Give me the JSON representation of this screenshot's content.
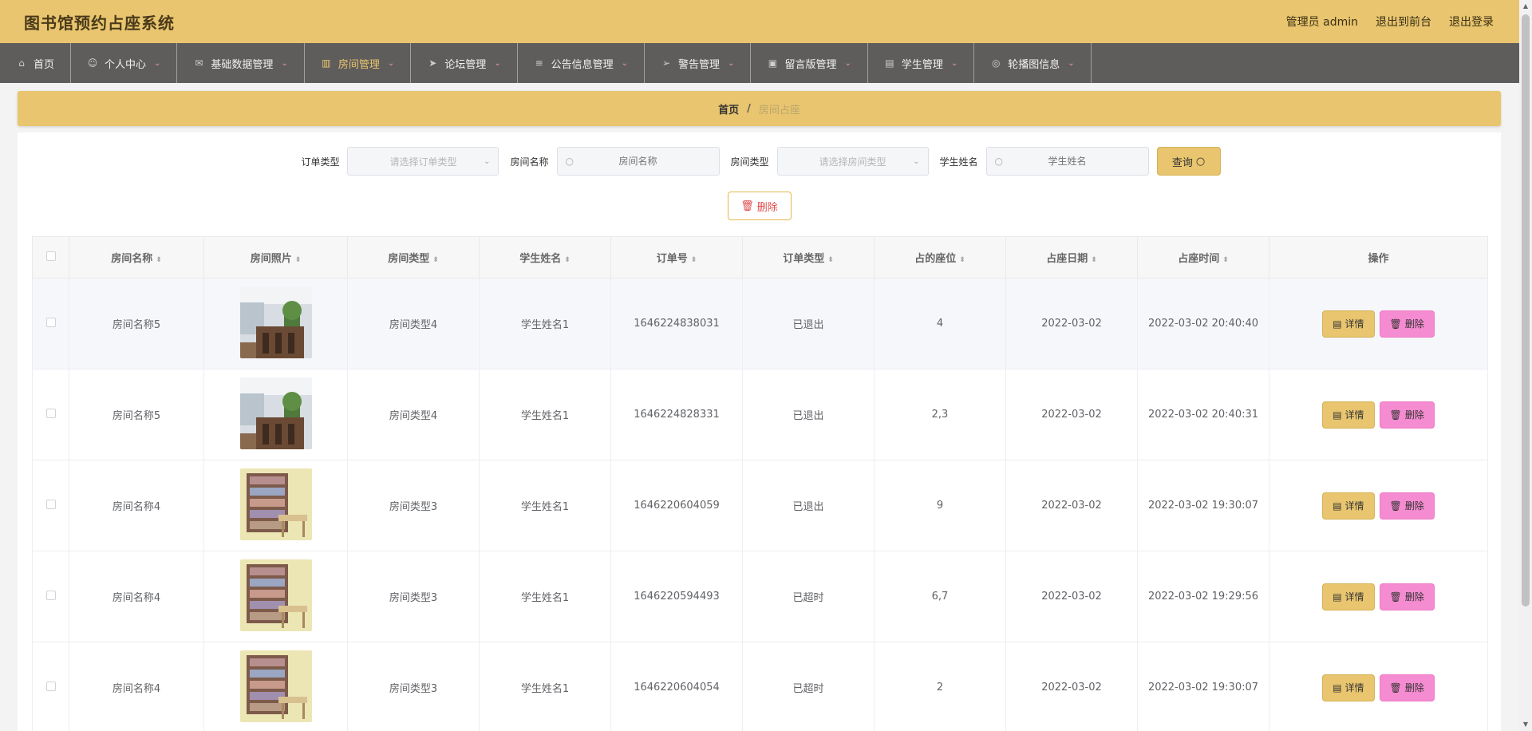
{
  "header": {
    "title": "图书馆预约占座系统",
    "admin_label": "管理员 admin",
    "to_front": "退出到前台",
    "logout": "退出登录"
  },
  "nav": [
    {
      "label": "首页",
      "icon": "home-icon",
      "glyph": "⌂",
      "has_caret": false
    },
    {
      "label": "个人中心",
      "icon": "user-icon",
      "glyph": "☺",
      "has_caret": true
    },
    {
      "label": "基础数据管理",
      "icon": "mail-icon",
      "glyph": "✉",
      "has_caret": true
    },
    {
      "label": "房间管理",
      "icon": "chart-icon",
      "glyph": "▥",
      "has_caret": true,
      "active": true
    },
    {
      "label": "论坛管理",
      "icon": "send-icon",
      "glyph": "➤",
      "has_caret": true
    },
    {
      "label": "公告信息管理",
      "icon": "list-icon",
      "glyph": "≡",
      "has_caret": true
    },
    {
      "label": "警告管理",
      "icon": "navigation-icon",
      "glyph": "➢",
      "has_caret": true
    },
    {
      "label": "留言版管理",
      "icon": "briefcase-icon",
      "glyph": "▣",
      "has_caret": true
    },
    {
      "label": "学生管理",
      "icon": "document-icon",
      "glyph": "▤",
      "has_caret": true
    },
    {
      "label": "轮播图信息",
      "icon": "compass-icon",
      "glyph": "◎",
      "has_caret": true
    }
  ],
  "breadcrumb": {
    "home": "首页",
    "separator": "/",
    "current": "房间占座"
  },
  "search": {
    "order_type_label": "订单类型",
    "order_type_placeholder": "请选择订单类型",
    "room_name_label": "房间名称",
    "room_name_placeholder": "房间名称",
    "room_type_label": "房间类型",
    "room_type_placeholder": "请选择房间类型",
    "student_label": "学生姓名",
    "student_placeholder": "学生姓名",
    "query_button": "查询"
  },
  "batch_delete": "删除",
  "table": {
    "columns": [
      "房间名称",
      "房间照片",
      "房间类型",
      "学生姓名",
      "订单号",
      "订单类型",
      "占的座位",
      "占座日期",
      "占座时间",
      "操作"
    ],
    "detail_label": "详情",
    "delete_label": "删除",
    "rows": [
      {
        "room": "房间名称5",
        "photo": "photo-room-a",
        "type": "房间类型4",
        "student": "学生姓名1",
        "order_no": "1646224838031",
        "order_type": "已退出",
        "seats": "4",
        "date": "2022-03-02",
        "time": "2022-03-02 20:40:40"
      },
      {
        "room": "房间名称5",
        "photo": "photo-room-a",
        "type": "房间类型4",
        "student": "学生姓名1",
        "order_no": "1646224828331",
        "order_type": "已退出",
        "seats": "2,3",
        "date": "2022-03-02",
        "time": "2022-03-02 20:40:31"
      },
      {
        "room": "房间名称4",
        "photo": "photo-room-b",
        "type": "房间类型3",
        "student": "学生姓名1",
        "order_no": "1646220604059",
        "order_type": "已退出",
        "seats": "9",
        "date": "2022-03-02",
        "time": "2022-03-02 19:30:07"
      },
      {
        "room": "房间名称4",
        "photo": "photo-room-b",
        "type": "房间类型3",
        "student": "学生姓名1",
        "order_no": "1646220594493",
        "order_type": "已超时",
        "seats": "6,7",
        "date": "2022-03-02",
        "time": "2022-03-02 19:29:56"
      },
      {
        "room": "房间名称4",
        "photo": "photo-room-b",
        "type": "房间类型3",
        "student": "学生姓名1",
        "order_no": "1646220604054",
        "order_type": "已超时",
        "seats": "2",
        "date": "2022-03-02",
        "time": "2022-03-02 19:30:07"
      }
    ]
  },
  "colors": {
    "accent": "#e8c56e",
    "nav_bg": "#5f5d5c",
    "delete_pink": "#f58bd0"
  }
}
